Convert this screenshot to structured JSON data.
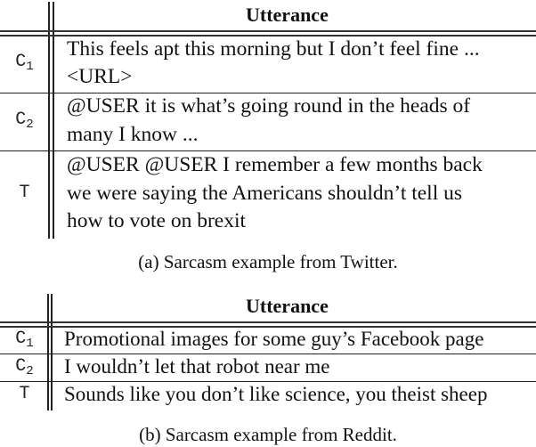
{
  "tables": [
    {
      "id": "a",
      "header": {
        "label_col": "",
        "utterance_col": "Utterance"
      },
      "rows": [
        {
          "label": "C",
          "sub": "1",
          "lines": [
            "This feels apt this morning but I don’t feel fine ...",
            "<URL>"
          ]
        },
        {
          "label": "C",
          "sub": "2",
          "lines": [
            "@USER it is what’s going round in the heads of",
            "many I know ..."
          ]
        },
        {
          "label": "T",
          "sub": "",
          "lines": [
            "@USER @USER I remember a few months back",
            "we were saying the Americans shouldn’t tell us",
            "how to vote on brexit"
          ]
        }
      ],
      "caption": "(a) Sarcasm example from Twitter."
    },
    {
      "id": "b",
      "header": {
        "label_col": "",
        "utterance_col": "Utterance"
      },
      "rows": [
        {
          "label": "C",
          "sub": "1",
          "lines": [
            "Promotional images for some guy’s Facebook page"
          ]
        },
        {
          "label": "C",
          "sub": "2",
          "lines": [
            "I wouldn’t let that robot near me"
          ]
        },
        {
          "label": "T",
          "sub": "",
          "lines": [
            "Sounds like you don’t like science, you theist sheep"
          ]
        }
      ],
      "caption": "(b) Sarcasm example from Reddit."
    }
  ]
}
